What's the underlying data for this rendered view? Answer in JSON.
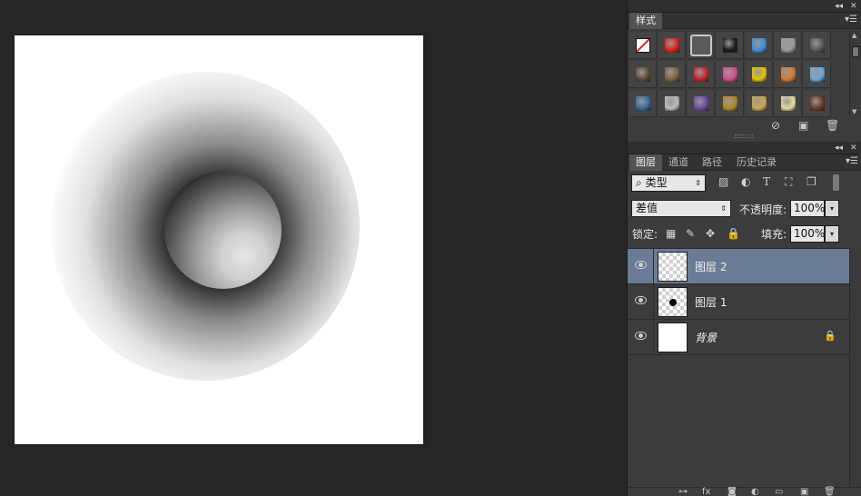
{
  "workspace": {
    "document_bg": "#ffffff",
    "app_bg": "#262626"
  },
  "styles_panel": {
    "tab_label": "样式",
    "collapse_icon": "double-chevron-left-icon",
    "close_icon": "close-icon",
    "menu_icon": "panel-menu-icon",
    "swatches": [
      {
        "name": "none-style",
        "icon": "no-style-swatch"
      },
      {
        "name": "red-glow",
        "color": "#e0201a"
      },
      {
        "name": "frame-outline",
        "color": "#8a8a8a"
      },
      {
        "name": "black-button",
        "color": "#1a1a1a"
      },
      {
        "name": "blue-glass",
        "color": "#3d8fd8"
      },
      {
        "name": "gray-square",
        "color": "#9a9a9a"
      },
      {
        "name": "dark-bevel",
        "color": "#555555"
      },
      {
        "name": "brown-flat",
        "color": "#5a4c35"
      },
      {
        "name": "brown-bevel",
        "color": "#7a6440"
      },
      {
        "name": "red-stripes",
        "color": "#c8202a"
      },
      {
        "name": "multicolor-tiles",
        "color": "#d84a8a"
      },
      {
        "name": "yellow-gem",
        "color": "#e8c400"
      },
      {
        "name": "orange-gradient",
        "color": "#d47a30"
      },
      {
        "name": "sky-blue",
        "color": "#6aa8e0"
      },
      {
        "name": "sunset-photo",
        "color": "#3a6aa0"
      },
      {
        "name": "silver-texture",
        "color": "#bbbbbb"
      },
      {
        "name": "purple-bevel",
        "color": "#6a4aa8"
      },
      {
        "name": "gold-ornate",
        "color": "#b08a20"
      },
      {
        "name": "gold-frame",
        "color": "#c8a848"
      },
      {
        "name": "cream-frame",
        "color": "#e8d8a0"
      },
      {
        "name": "wood-frame",
        "color": "#6a3a20"
      }
    ],
    "footer_icons": [
      "clear-style-icon",
      "new-style-icon",
      "delete-icon"
    ]
  },
  "layers_panel": {
    "tabs": [
      {
        "label": "图层",
        "active": true
      },
      {
        "label": "通道",
        "active": false
      },
      {
        "label": "路径",
        "active": false
      },
      {
        "label": "历史记录",
        "active": false
      }
    ],
    "filter": {
      "kind_label": "类型",
      "icons": [
        "image-filter-icon",
        "adjustment-filter-icon",
        "type-filter-icon",
        "shape-filter-icon",
        "smart-object-filter-icon"
      ]
    },
    "blend_mode": "差值",
    "opacity_label": "不透明度:",
    "opacity_value": "100%",
    "lock_label": "锁定:",
    "lock_icons": [
      "lock-transparency-icon",
      "lock-paint-icon",
      "lock-position-icon",
      "lock-all-icon"
    ],
    "fill_label": "填充:",
    "fill_value": "100%",
    "layers": [
      {
        "name": "图层 2",
        "selected": true,
        "thumb": "transparent",
        "locked": false,
        "italic": false
      },
      {
        "name": "图层 1",
        "selected": false,
        "thumb": "dot",
        "locked": false,
        "italic": false
      },
      {
        "name": "背景",
        "selected": false,
        "thumb": "white",
        "locked": true,
        "italic": true
      }
    ],
    "footer_icons": [
      "link-layers-icon",
      "fx-icon",
      "mask-icon",
      "adjustment-layer-icon",
      "group-icon",
      "new-layer-icon",
      "delete-layer-icon"
    ]
  }
}
